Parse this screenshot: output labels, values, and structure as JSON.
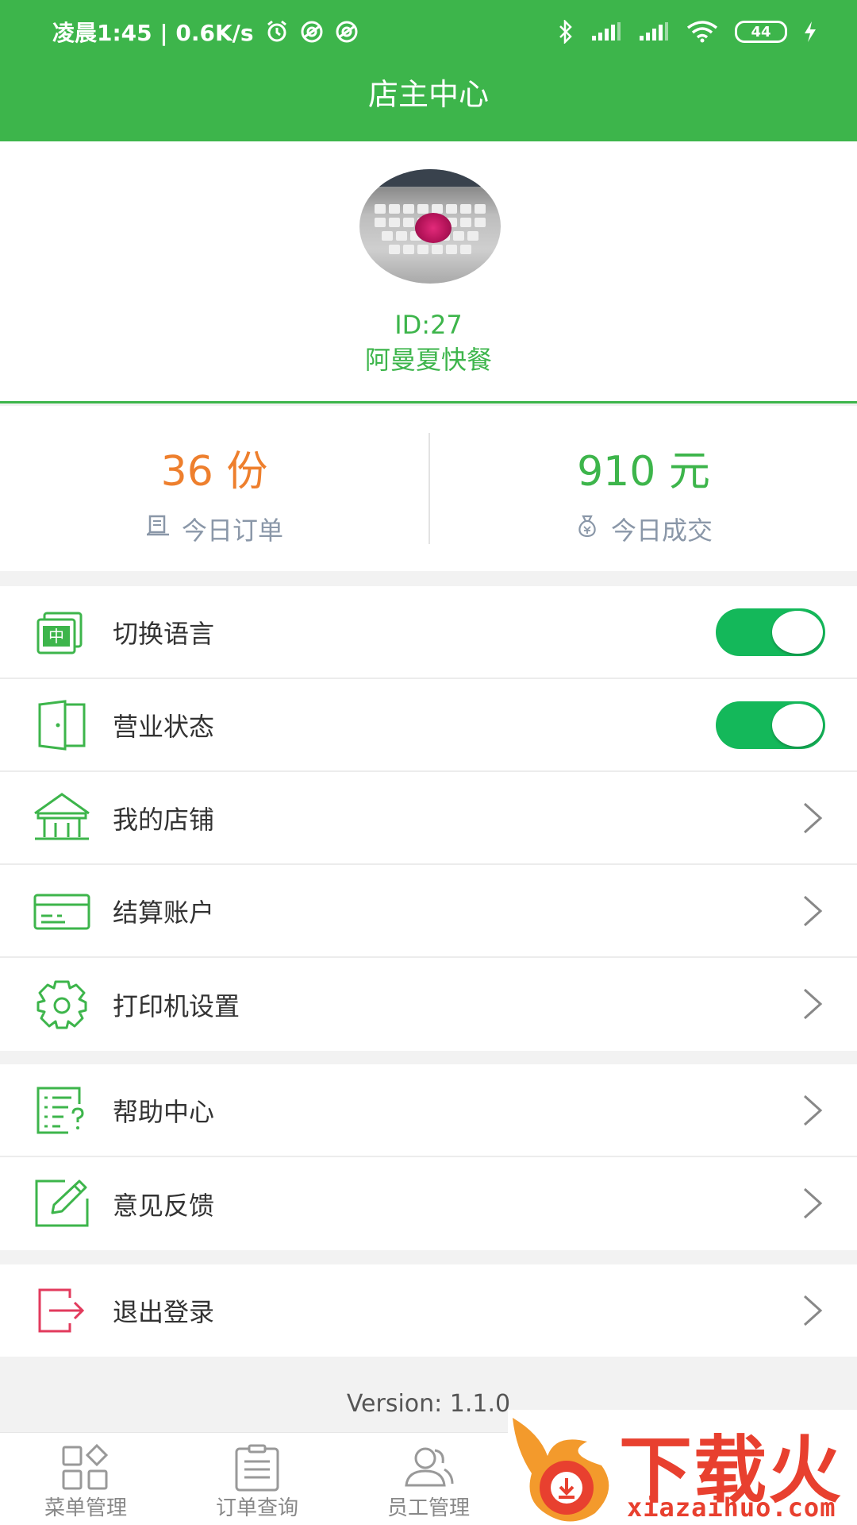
{
  "status_bar": {
    "time_speed": "凌晨1:45 | 0.6K/s",
    "battery": "44"
  },
  "header": {
    "title": "店主中心"
  },
  "profile": {
    "id_text": "ID:27",
    "shop_name": "阿曼夏快餐"
  },
  "stats": {
    "orders_value": "36 份",
    "orders_label": "今日订单",
    "revenue_value": "910 元",
    "revenue_label": "今日成交"
  },
  "settings": {
    "group1": [
      {
        "label": "切换语言",
        "icon": "language-icon",
        "control": "toggle",
        "on": true
      },
      {
        "label": "营业状态",
        "icon": "door-icon",
        "control": "toggle",
        "on": true
      },
      {
        "label": "我的店铺",
        "icon": "store-icon",
        "control": "chevron"
      },
      {
        "label": "结算账户",
        "icon": "card-icon",
        "control": "chevron"
      },
      {
        "label": "打印机设置",
        "icon": "gear-icon",
        "control": "chevron"
      }
    ],
    "group2": [
      {
        "label": "帮助中心",
        "icon": "help-list-icon",
        "control": "chevron"
      },
      {
        "label": "意见反馈",
        "icon": "edit-icon",
        "control": "chevron"
      }
    ],
    "group3": [
      {
        "label": "退出登录",
        "icon": "logout-icon",
        "control": "chevron"
      }
    ]
  },
  "footer": {
    "version": "Version: 1.1.0"
  },
  "tabbar": {
    "tabs": [
      {
        "label": "菜单管理",
        "icon": "grid-icon"
      },
      {
        "label": "订单查询",
        "icon": "clipboard-icon"
      },
      {
        "label": "员工管理",
        "icon": "staff-icon"
      }
    ]
  },
  "watermark": {
    "title": "下载火",
    "url": "xiazaihuo.com"
  },
  "colors": {
    "primary_green": "#3db54b",
    "toggle_green": "#14b85a",
    "orders_orange": "#ee7f2d",
    "logout_red": "#e23a5c"
  }
}
